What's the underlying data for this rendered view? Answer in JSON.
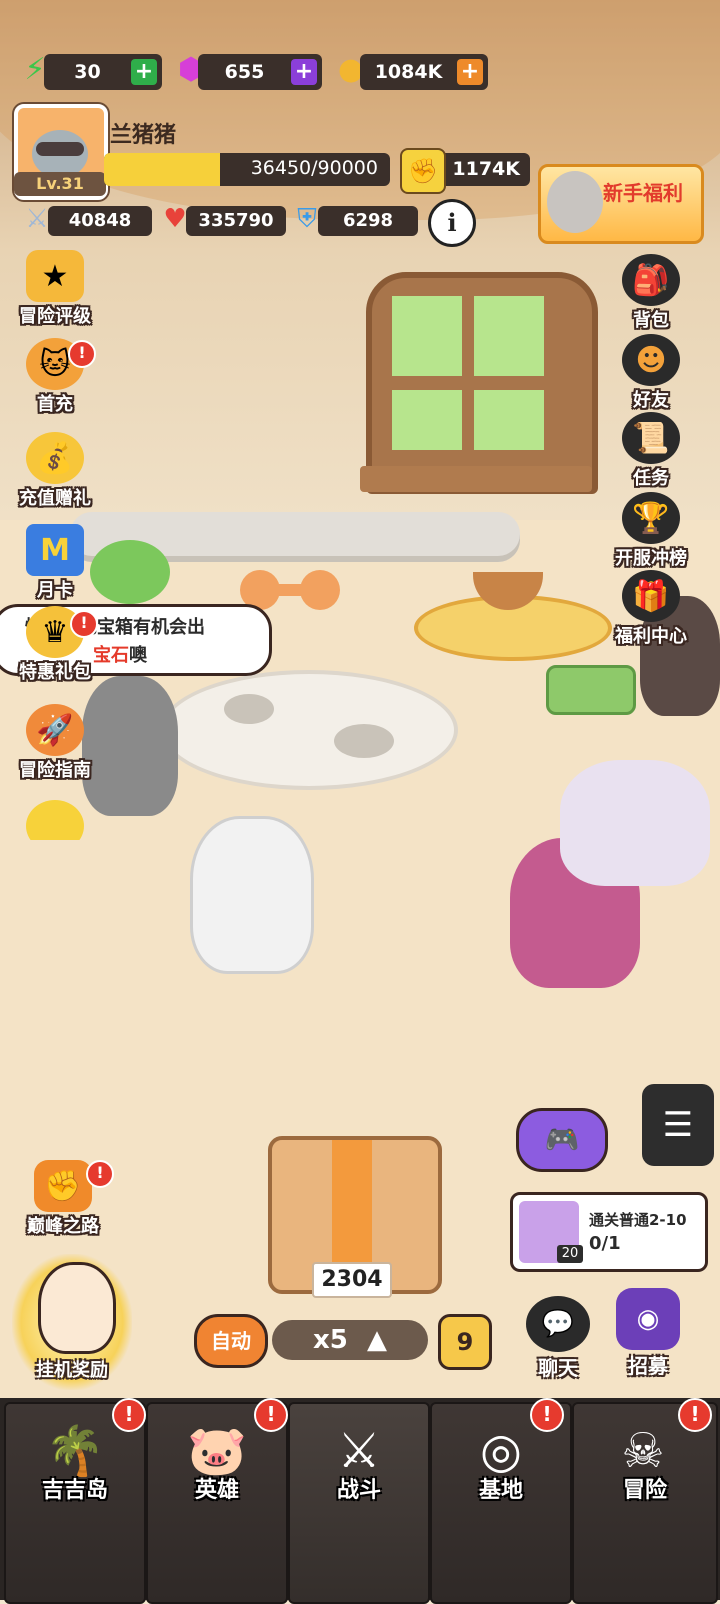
{
  "resources": {
    "energy": {
      "value": "30",
      "icon": "lightning-icon"
    },
    "gems": {
      "value": "655",
      "icon": "gem-icon"
    },
    "coins": {
      "value": "1084K",
      "icon": "coin-icon"
    }
  },
  "player": {
    "name": "兰猪猪",
    "level": "Lv.31",
    "xp_text": "36450/90000",
    "xp_fraction": 0.405,
    "power": "1174K"
  },
  "stats": {
    "attack": "40848",
    "health": "335790",
    "defense": "6298"
  },
  "promo": {
    "newbie_label": "新手福利"
  },
  "left_menu": [
    {
      "label": "冒险评级",
      "icon": "star-badge-icon"
    },
    {
      "label": "首充",
      "icon": "cat-gift-icon",
      "alert": "!"
    },
    {
      "label": "充值赠礼",
      "icon": "money-bag-icon"
    },
    {
      "label": "月卡",
      "icon": "month-card-icon"
    },
    {
      "label": "特惠礼包",
      "icon": "crown-gift-icon",
      "alert": "!"
    },
    {
      "label": "冒险指南",
      "icon": "rocket-icon"
    }
  ],
  "right_menu": [
    {
      "label": "背包",
      "icon": "backpack-icon"
    },
    {
      "label": "好友",
      "icon": "friends-icon"
    },
    {
      "label": "任务",
      "icon": "scroll-icon"
    },
    {
      "label": "开服冲榜",
      "icon": "trophy-icon"
    },
    {
      "label": "福利中心",
      "icon": "gift-box-icon"
    }
  ],
  "bubble": {
    "line1": "惊喜！挖宝箱有机会出",
    "line2_red": "宝石",
    "line2_rest": "噢"
  },
  "peak_road": {
    "label": "巅峰之路",
    "alert": "!"
  },
  "idle_reward": {
    "label": "挂机奖励"
  },
  "chest": {
    "count": "2304"
  },
  "controls": {
    "auto_label": "自动",
    "speed_label": "x5",
    "wave": "9"
  },
  "quest": {
    "title": "通关普通2-10",
    "progress": "0/1",
    "item_count": "20"
  },
  "chat_label": "聊天",
  "recruit_label": "招募",
  "bottom_nav": [
    {
      "label": "吉吉岛",
      "icon": "palm-island-icon",
      "alert": "!"
    },
    {
      "label": "英雄",
      "icon": "hero-pig-icon",
      "alert": "!"
    },
    {
      "label": "战斗",
      "icon": "crossed-swords-icon"
    },
    {
      "label": "基地",
      "icon": "base-tower-icon",
      "alert": "!"
    },
    {
      "label": "冒险",
      "icon": "skull-icon",
      "alert": "!"
    }
  ],
  "colors": {
    "xp": "#f6d03a",
    "energy_plus": "#2fae4a",
    "gem_plus": "#8b3fd9",
    "coin_plus": "#ee8a2a",
    "alert": "#e63a2e"
  }
}
